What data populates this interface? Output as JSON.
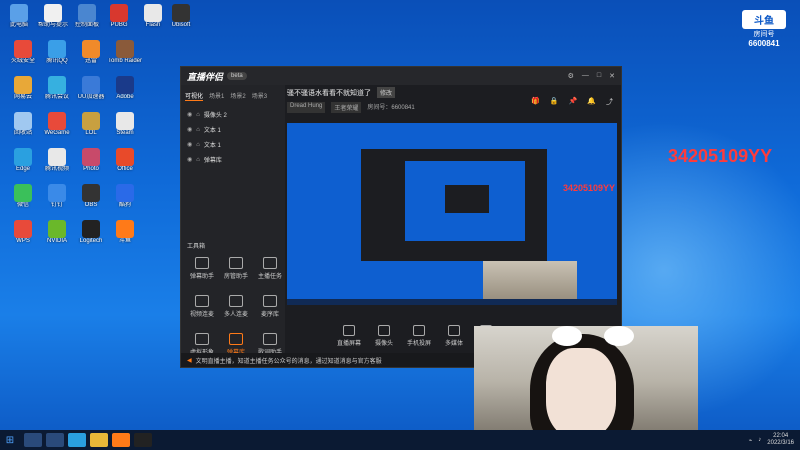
{
  "desktop": {
    "icons": [
      {
        "label": "此电脑",
        "color": "#5aa0e8"
      },
      {
        "label": "帮助与提示",
        "color": "#f0f0f0"
      },
      {
        "label": "控制面板",
        "color": "#4a86d0"
      },
      {
        "label": "PUBG",
        "color": "#d8382e"
      },
      {
        "label": "Flash",
        "color": "#e8e8e8"
      },
      {
        "label": "Ubisoft",
        "color": "#333"
      },
      {
        "label": "火绒安全",
        "color": "#e84a3a"
      },
      {
        "label": "腾讯QQ",
        "color": "#3a9fe8"
      },
      {
        "label": "迅雷",
        "color": "#f08a2a"
      },
      {
        "label": "Tomb Raider",
        "color": "#8a5a3a"
      },
      {
        "label": "网易云",
        "color": "#e8a838"
      },
      {
        "label": "腾讯会议",
        "color": "#36b0e0"
      },
      {
        "label": "UU加速器",
        "color": "#3a7ad8"
      },
      {
        "label": "Adobe",
        "color": "#1a3a8a"
      },
      {
        "label": "回收站",
        "color": "#a0c8f0"
      },
      {
        "label": "WeGame",
        "color": "#e84a3a"
      },
      {
        "label": "LOL",
        "color": "#c8a040"
      },
      {
        "label": "Steam",
        "color": "#e8e8e8"
      },
      {
        "label": "Edge",
        "color": "#2aa0e0"
      },
      {
        "label": "腾讯视频",
        "color": "#e8e8e8"
      },
      {
        "label": "Photo",
        "color": "#c84a6a"
      },
      {
        "label": "Office",
        "color": "#e84a2a"
      },
      {
        "label": "微信",
        "color": "#3ac05a"
      },
      {
        "label": "钉钉",
        "color": "#3a8ae8"
      },
      {
        "label": "OBS",
        "color": "#333"
      },
      {
        "label": "酷狗",
        "color": "#2a6ae8"
      },
      {
        "label": "WPS",
        "color": "#e84a3a"
      },
      {
        "label": "NVIDIA",
        "color": "#6ab82a"
      },
      {
        "label": "Logitech",
        "color": "#222"
      },
      {
        "label": "斗鱼",
        "color": "#ff7a18"
      }
    ],
    "douyu_logo": "斗鱼",
    "douyu_room_label": "房间号",
    "room_number": "6600841",
    "overlay_text": "34205109YY"
  },
  "app": {
    "logo": "直播伴侣",
    "version": "beta",
    "side_tabs": [
      "可视化",
      "场景1",
      "场景2",
      "场景3"
    ],
    "sources": [
      "摄像头 2",
      "文本 1",
      "文本 1",
      "弹幕库"
    ],
    "tools_title": "工具箱",
    "tools": [
      {
        "label": "弹幕助手",
        "hot": false
      },
      {
        "label": "房管助手",
        "hot": false
      },
      {
        "label": "主播任务",
        "hot": false
      },
      {
        "label": "视频连麦",
        "hot": false
      },
      {
        "label": "多人连麦",
        "hot": false
      },
      {
        "label": "麦序库",
        "hot": false
      },
      {
        "label": "虚拟形象",
        "hot": false
      },
      {
        "label": "弹幕库",
        "hot": true
      },
      {
        "label": "歌词助手",
        "hot": false
      }
    ],
    "stream_title": "骚不骚语水看看不就知道了",
    "title_tag": "修改",
    "category": "Dread Hung",
    "category_tag": "王者荣耀",
    "room_label": "房间号：6600841",
    "mini_yy": "34205109YY",
    "bottom_actions": [
      "直播屏幕",
      "摄像头",
      "手机投屏",
      "多媒体",
      "麦克风"
    ],
    "notice": "文明直播主播，知道主播任务公众号的消息，通过知道消息与官方客服"
  },
  "taskbar": {
    "time": "22:04",
    "date": "2022/3/16"
  }
}
